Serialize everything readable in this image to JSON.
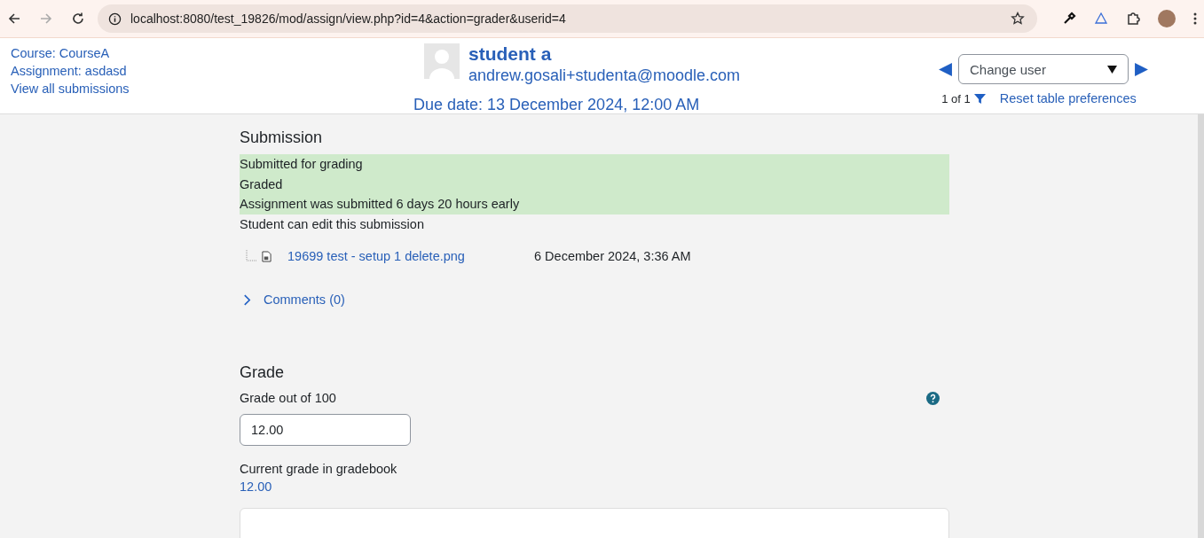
{
  "browser": {
    "url": "localhost:8080/test_19826/mod/assign/view.php?id=4&action=grader&userid=4"
  },
  "header": {
    "links": [
      "Course: CourseA",
      "Assignment: asdasd",
      "View all submissions"
    ],
    "user": {
      "name": "student a",
      "email": "andrew.gosali+studenta@moodle.com",
      "due": "Due date: 13 December 2024, 12:00 AM"
    },
    "change_user": {
      "placeholder": "Change user",
      "count": "1 of 1",
      "reset": "Reset table preferences"
    }
  },
  "submission": {
    "heading": "Submission",
    "status": [
      {
        "text": "Submitted for grading",
        "highlighted": true
      },
      {
        "text": "Graded",
        "highlighted": true
      },
      {
        "text": "Assignment was submitted 6 days 20 hours early",
        "highlighted": true
      },
      {
        "text": "Student can edit this submission",
        "highlighted": false
      }
    ],
    "file": {
      "name": "19699 test - setup 1 delete.png",
      "date": "6 December 2024, 3:36 AM"
    },
    "comments": {
      "label": "Comments (0)",
      "expanded": false
    }
  },
  "grade": {
    "heading": "Grade",
    "label": "Grade out of 100",
    "value": "12.00",
    "current_label": "Current grade in gradebook",
    "current_value": "12.00"
  }
}
